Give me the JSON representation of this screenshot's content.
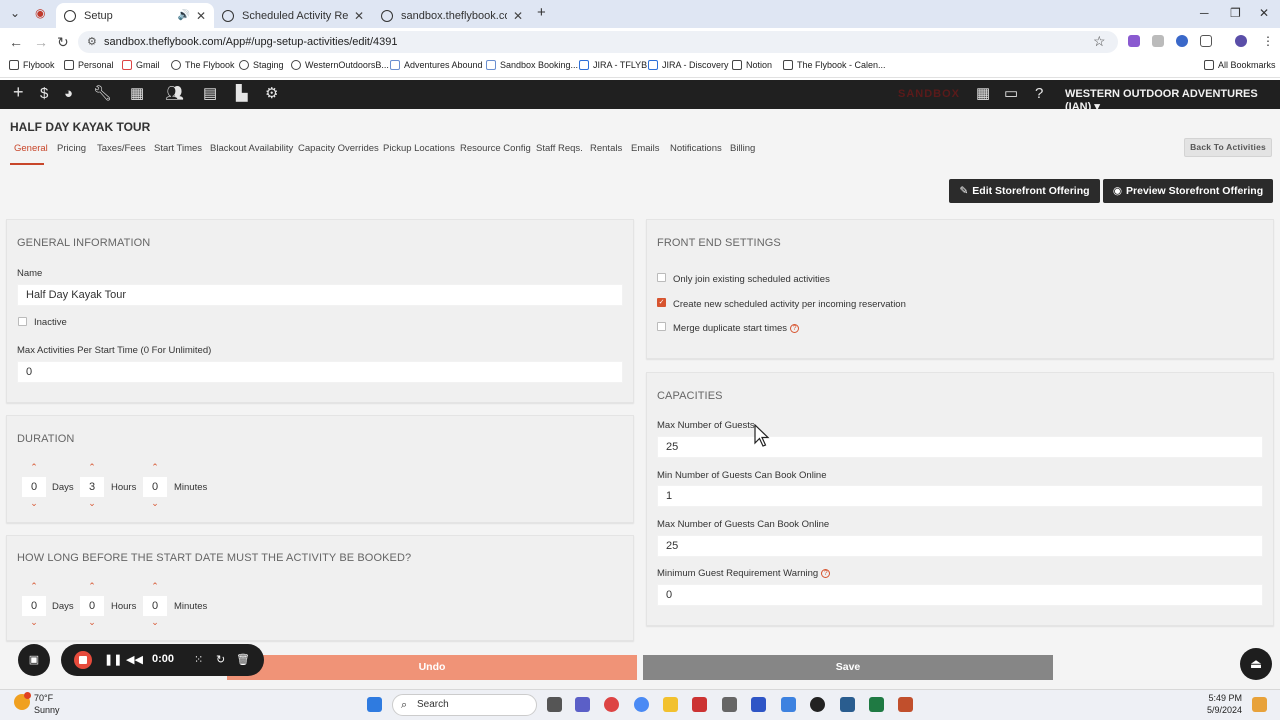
{
  "browser": {
    "tabs": [
      {
        "label": "Setup",
        "active": true
      },
      {
        "label": "Scheduled Activity Report",
        "active": false
      },
      {
        "label": "sandbox.theflybook.com/App#",
        "active": false
      }
    ],
    "url": "sandbox.theflybook.com/App#/upg-setup-activities/edit/4391",
    "bookmarks": [
      "Flybook",
      "Personal",
      "Gmail",
      "The Flybook",
      "Staging",
      "WesternOutdoorsB...",
      "Adventures Abound",
      "Sandbox Booking...",
      "JIRA - TFLYB",
      "JIRA - Discovery",
      "Notion",
      "The Flybook - Calen..."
    ],
    "all_bookmarks": "All Bookmarks"
  },
  "appnav": {
    "sandbox_label": "SANDBOX",
    "company": "WESTERN OUTDOOR ADVENTURES (IAN)"
  },
  "page": {
    "title": "HALF DAY KAYAK TOUR",
    "tabs": [
      "General",
      "Pricing",
      "Taxes/Fees",
      "Start Times",
      "Blackout Availability",
      "Capacity Overrides",
      "Pickup Locations",
      "Resource Config",
      "Staff Reqs.",
      "Rentals",
      "Emails",
      "Notifications",
      "Billing"
    ],
    "back_button": "Back To Activities",
    "edit_storefront": "Edit Storefront Offering",
    "preview_storefront": "Preview Storefront Offering"
  },
  "general": {
    "title": "GENERAL INFORMATION",
    "name_label": "Name",
    "name_value": "Half Day Kayak Tour",
    "inactive_label": "Inactive",
    "max_activities_label": "Max Activities Per Start Time (0 For Unlimited)",
    "max_activities_value": "0"
  },
  "duration": {
    "title": "DURATION",
    "days": "0",
    "days_label": "Days",
    "hours": "3",
    "hours_label": "Hours",
    "minutes": "0",
    "minutes_label": "Minutes"
  },
  "booking_lead": {
    "title": "HOW LONG BEFORE THE START DATE MUST THE ACTIVITY BE BOOKED?",
    "days": "0",
    "days_label": "Days",
    "hours": "0",
    "hours_label": "Hours",
    "minutes": "0",
    "minutes_label": "Minutes"
  },
  "frontend": {
    "title": "FRONT END SETTINGS",
    "opt1": "Only join existing scheduled activities",
    "opt2": "Create new scheduled activity per incoming reservation",
    "opt3": "Merge duplicate start times"
  },
  "capacities": {
    "title": "CAPACITIES",
    "max_guests_label": "Max Number of Guests",
    "max_guests_value": "25",
    "min_online_label": "Min Number of Guests Can Book Online",
    "min_online_value": "1",
    "max_online_label": "Max Number of Guests Can Book Online",
    "max_online_value": "25",
    "min_warning_label": "Minimum Guest Requirement Warning",
    "min_warning_value": "0"
  },
  "actions": {
    "undo": "Undo",
    "save": "Save"
  },
  "recorder": {
    "time": "0:00"
  },
  "taskbar": {
    "temp": "70°F",
    "condition": "Sunny",
    "search_placeholder": "Search",
    "time": "5:49 PM",
    "date": "5/9/2024"
  },
  "colors": {
    "accent": "#d7542f",
    "nav_bg": "#202020"
  }
}
